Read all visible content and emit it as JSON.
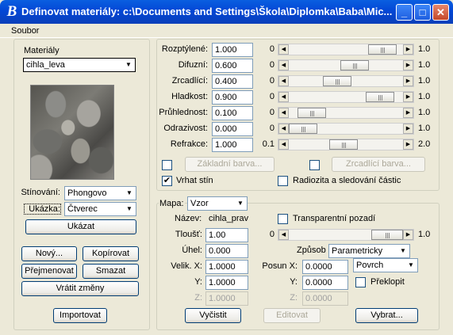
{
  "window": {
    "title": "Definovat materiály: c:\\Documents and Settings\\Škola\\Diplomka\\Baba\\Mic...",
    "buttons": {
      "minimize": "_",
      "maximize": "□",
      "close": "✕"
    }
  },
  "menu": {
    "soubor": "Soubor"
  },
  "left": {
    "materials_label": "Materiály",
    "material_selected": "cihla_leva",
    "shading_label": "Stínování:",
    "shading_value": "Phongovo",
    "preview_shape_label": "Ukázka:",
    "preview_shape_value": "Čtverec",
    "show_button": "Ukázat",
    "new_button": "Nový...",
    "copy_button": "Kopírovat",
    "rename_button": "Přejmenovat",
    "delete_button": "Smazat",
    "revert_button": "Vrátit změny",
    "import_button": "Importovat"
  },
  "properties": {
    "rows": [
      {
        "label": "Rozptýlené:",
        "value": "1.000",
        "min": "0",
        "max": "1.0",
        "level": 0.93
      },
      {
        "label": "Difuzní:",
        "value": "0.600",
        "min": "0",
        "max": "1.0",
        "level": 0.6
      },
      {
        "label": "Zrcadlící:",
        "value": "0.400",
        "min": "0",
        "max": "1.0",
        "level": 0.4
      },
      {
        "label": "Hladkost:",
        "value": "0.900",
        "min": "0",
        "max": "1.0",
        "level": 0.9
      },
      {
        "label": "Průhlednost:",
        "value": "0.100",
        "min": "0",
        "max": "1.0",
        "level": 0.1
      },
      {
        "label": "Odrazivost:",
        "value": "0.000",
        "min": "0",
        "max": "1.0",
        "level": 0.0
      },
      {
        "label": "Refrakce:",
        "value": "1.000",
        "min": "0.1",
        "max": "2.0",
        "level": 0.47
      }
    ],
    "base_color_button": "Základní barva...",
    "mirror_color_button": "Zrcadlící barva...",
    "cast_shadow_label": "Vrhat stín",
    "cast_shadow_checked": "✔",
    "radiosity_label": "Radiozita a sledování částic"
  },
  "map": {
    "label": "Mapa:",
    "type_value": "Vzor",
    "name_label": "Název:",
    "name_value": "cihla_prav",
    "transparent_bg_label": "Transparentní pozadí",
    "thickness_label": "Tloušť:",
    "thickness_value": "1.00",
    "thickness_min": "0",
    "thickness_max": "1.0",
    "thickness_level": 1.0,
    "angle_label": "Úhel:",
    "angle_value": "0.000",
    "mode_label": "Způsob",
    "mode_value": "Parametricky",
    "size_x_label": "Velik. X:",
    "size_x_value": "1.0000",
    "size_y_label": "Y:",
    "size_y_value": "1.0000",
    "size_z_label": "Z:",
    "size_z_value": "1.0000",
    "offset_x_label": "Posun X:",
    "offset_x_value": "0.0000",
    "offset_y_label": "Y:",
    "offset_y_value": "0.0000",
    "offset_z_label": "Z:",
    "offset_z_value": "0.0000",
    "surface_value": "Povrch",
    "flip_label": "Překlopit",
    "clear_button": "Vyčistit",
    "edit_button": "Editovat",
    "choose_button": "Vybrat..."
  }
}
